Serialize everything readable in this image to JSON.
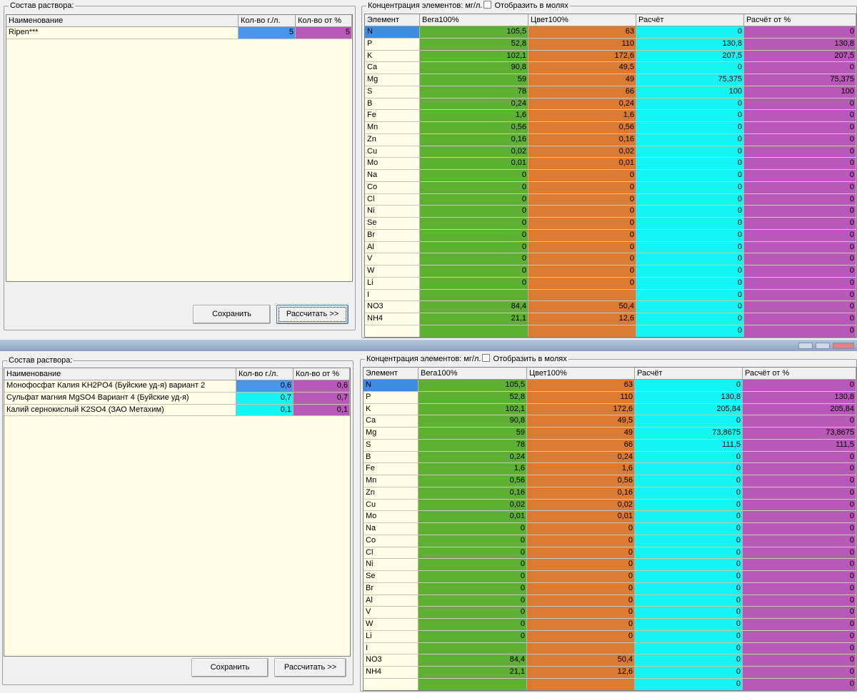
{
  "panels": [
    {
      "solution": {
        "legend": "Состав раствора:",
        "headers": [
          "Наименование",
          "Кол-во г./л.",
          "Кол-во от %"
        ],
        "rows": [
          {
            "name": "Ripen***",
            "qty": "5",
            "pct": "5",
            "qty_color": "blue"
          }
        ]
      },
      "concentration": {
        "legend": "Концентрация элементов: мг/л.",
        "moles_label": "Отобразить в молях",
        "headers": [
          "Элемент",
          "Вега100%",
          "Цвет100%",
          "Расчёт",
          "Расчёт от %"
        ],
        "rows": [
          [
            "N",
            "105,5",
            "63",
            "0",
            "0"
          ],
          [
            "P",
            "52,8",
            "110",
            "130,8",
            "130,8"
          ],
          [
            "K",
            "102,1",
            "172,6",
            "207,5",
            "207,5"
          ],
          [
            "Ca",
            "90,8",
            "49,5",
            "0",
            "0"
          ],
          [
            "Mg",
            "59",
            "49",
            "75,375",
            "75,375"
          ],
          [
            "S",
            "78",
            "66",
            "100",
            "100"
          ],
          [
            "B",
            "0,24",
            "0,24",
            "0",
            "0"
          ],
          [
            "Fe",
            "1,6",
            "1,6",
            "0",
            "0"
          ],
          [
            "Mn",
            "0,56",
            "0,56",
            "0",
            "0"
          ],
          [
            "Zn",
            "0,16",
            "0,16",
            "0",
            "0"
          ],
          [
            "Cu",
            "0,02",
            "0,02",
            "0",
            "0"
          ],
          [
            "Mo",
            "0,01",
            "0,01",
            "0",
            "0"
          ],
          [
            "Na",
            "0",
            "0",
            "0",
            "0"
          ],
          [
            "Co",
            "0",
            "0",
            "0",
            "0"
          ],
          [
            "Cl",
            "0",
            "0",
            "0",
            "0"
          ],
          [
            "Ni",
            "0",
            "0",
            "0",
            "0"
          ],
          [
            "Se",
            "0",
            "0",
            "0",
            "0"
          ],
          [
            "Br",
            "0",
            "0",
            "0",
            "0"
          ],
          [
            "Al",
            "0",
            "0",
            "0",
            "0"
          ],
          [
            "V",
            "0",
            "0",
            "0",
            "0"
          ],
          [
            "W",
            "0",
            "0",
            "0",
            "0"
          ],
          [
            "Li",
            "0",
            "0",
            "0",
            "0"
          ],
          [
            "I",
            "",
            "",
            "0",
            "0"
          ],
          [
            "NO3",
            "84,4",
            "50,4",
            "0",
            "0"
          ],
          [
            "NH4",
            "21,1",
            "12,6",
            "0",
            "0"
          ],
          [
            "",
            "",
            "",
            "0",
            "0"
          ]
        ]
      },
      "buttons": {
        "save": "Сохранить",
        "calc": "Рассчитать >>"
      }
    },
    {
      "solution": {
        "legend": "Состав раствора:",
        "headers": [
          "Наименование",
          "Кол-во г./л.",
          "Кол-во от %"
        ],
        "rows": [
          {
            "name": "Монофосфат Калия KH2PO4 (Буйские уд-я) вариант 2",
            "qty": "0,6",
            "pct": "0,6",
            "qty_color": "blue"
          },
          {
            "name": "Сульфат магния MgSO4 Вариант 4 (Буйские уд-я)",
            "qty": "0,7",
            "pct": "0,7",
            "qty_color": "cyan"
          },
          {
            "name": "Калий  сернокислый  K2SO4 (ЗАО Метахим)",
            "qty": "0,1",
            "pct": "0,1",
            "qty_color": "cyan"
          }
        ]
      },
      "concentration": {
        "legend": "Концентрация элементов: мг/л.",
        "moles_label": "Отобразить в молях",
        "headers": [
          "Элемент",
          "Вега100%",
          "Цвет100%",
          "Расчёт",
          "Расчёт от %"
        ],
        "rows": [
          [
            "N",
            "105,5",
            "63",
            "0",
            "0"
          ],
          [
            "P",
            "52,8",
            "110",
            "130,8",
            "130,8"
          ],
          [
            "K",
            "102,1",
            "172,6",
            "205,84",
            "205,84"
          ],
          [
            "Ca",
            "90,8",
            "49,5",
            "0",
            "0"
          ],
          [
            "Mg",
            "59",
            "49",
            "73,8675",
            "73,8675"
          ],
          [
            "S",
            "78",
            "66",
            "111,5",
            "111,5"
          ],
          [
            "B",
            "0,24",
            "0,24",
            "0",
            "0"
          ],
          [
            "Fe",
            "1,6",
            "1,6",
            "0",
            "0"
          ],
          [
            "Mn",
            "0,56",
            "0,56",
            "0",
            "0"
          ],
          [
            "Zn",
            "0,16",
            "0,16",
            "0",
            "0"
          ],
          [
            "Cu",
            "0,02",
            "0,02",
            "0",
            "0"
          ],
          [
            "Mo",
            "0,01",
            "0,01",
            "0",
            "0"
          ],
          [
            "Na",
            "0",
            "0",
            "0",
            "0"
          ],
          [
            "Co",
            "0",
            "0",
            "0",
            "0"
          ],
          [
            "Cl",
            "0",
            "0",
            "0",
            "0"
          ],
          [
            "Ni",
            "0",
            "0",
            "0",
            "0"
          ],
          [
            "Se",
            "0",
            "0",
            "0",
            "0"
          ],
          [
            "Br",
            "0",
            "0",
            "0",
            "0"
          ],
          [
            "Al",
            "0",
            "0",
            "0",
            "0"
          ],
          [
            "V",
            "0",
            "0",
            "0",
            "0"
          ],
          [
            "W",
            "0",
            "0",
            "0",
            "0"
          ],
          [
            "Li",
            "0",
            "0",
            "0",
            "0"
          ],
          [
            "I",
            "",
            "",
            "0",
            "0"
          ],
          [
            "NO3",
            "84,4",
            "50,4",
            "0",
            "0"
          ],
          [
            "NH4",
            "21,1",
            "12,6",
            "0",
            "0"
          ],
          [
            "",
            "",
            "",
            "0",
            "0"
          ]
        ]
      },
      "buttons": {
        "save": "Сохранить",
        "calc": "Рассчитать >>"
      }
    }
  ],
  "colors": {
    "vega": "#5db034",
    "tsvet": "#db7a31",
    "calc": "#14f4f4",
    "calc_pct": "#b858b8",
    "selected": "#4a94ea",
    "grid_bg": "#fffde6"
  }
}
